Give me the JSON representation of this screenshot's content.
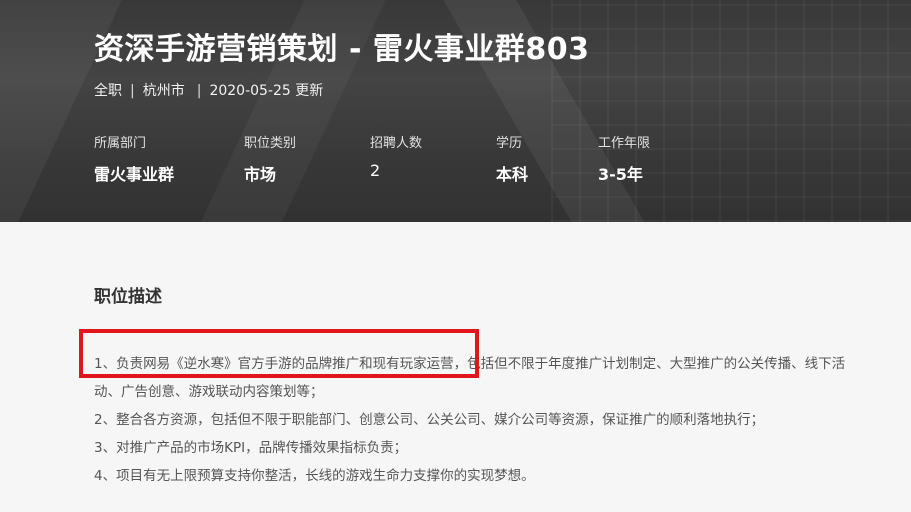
{
  "header": {
    "title": "资深手游营销策划 - 雷火事业群803",
    "meta": {
      "type": "全职",
      "city": "杭州市",
      "updated": "2020-05-25 更新",
      "separator": "|"
    },
    "attributes": [
      {
        "label": "所属部门",
        "value": "雷火事业群"
      },
      {
        "label": "职位类别",
        "value": "市场"
      },
      {
        "label": "招聘人数",
        "value": "2"
      },
      {
        "label": "学历",
        "value": "本科"
      },
      {
        "label": "工作年限",
        "value": "3-5年"
      }
    ]
  },
  "description": {
    "title": "职位描述",
    "items": [
      "1、负责网易《逆水寒》官方手游的品牌推广和现有玩家运营，包括但不限于年度推广计划制定、大型推广的公关传播、线下活动、广告创意、游戏联动内容策划等；",
      "2、整合各方资源，包括但不限于职能部门、创意公司、公关公司、媒介公司等资源，保证推广的顺利落地执行；",
      "3、对推广产品的市场KPI，品牌传播效果指标负责；",
      "4、项目有无上限预算支持你整活，长线的游戏生命力支撑你的实现梦想。"
    ]
  },
  "annotation": {
    "highlight_color": "#e0161c"
  }
}
